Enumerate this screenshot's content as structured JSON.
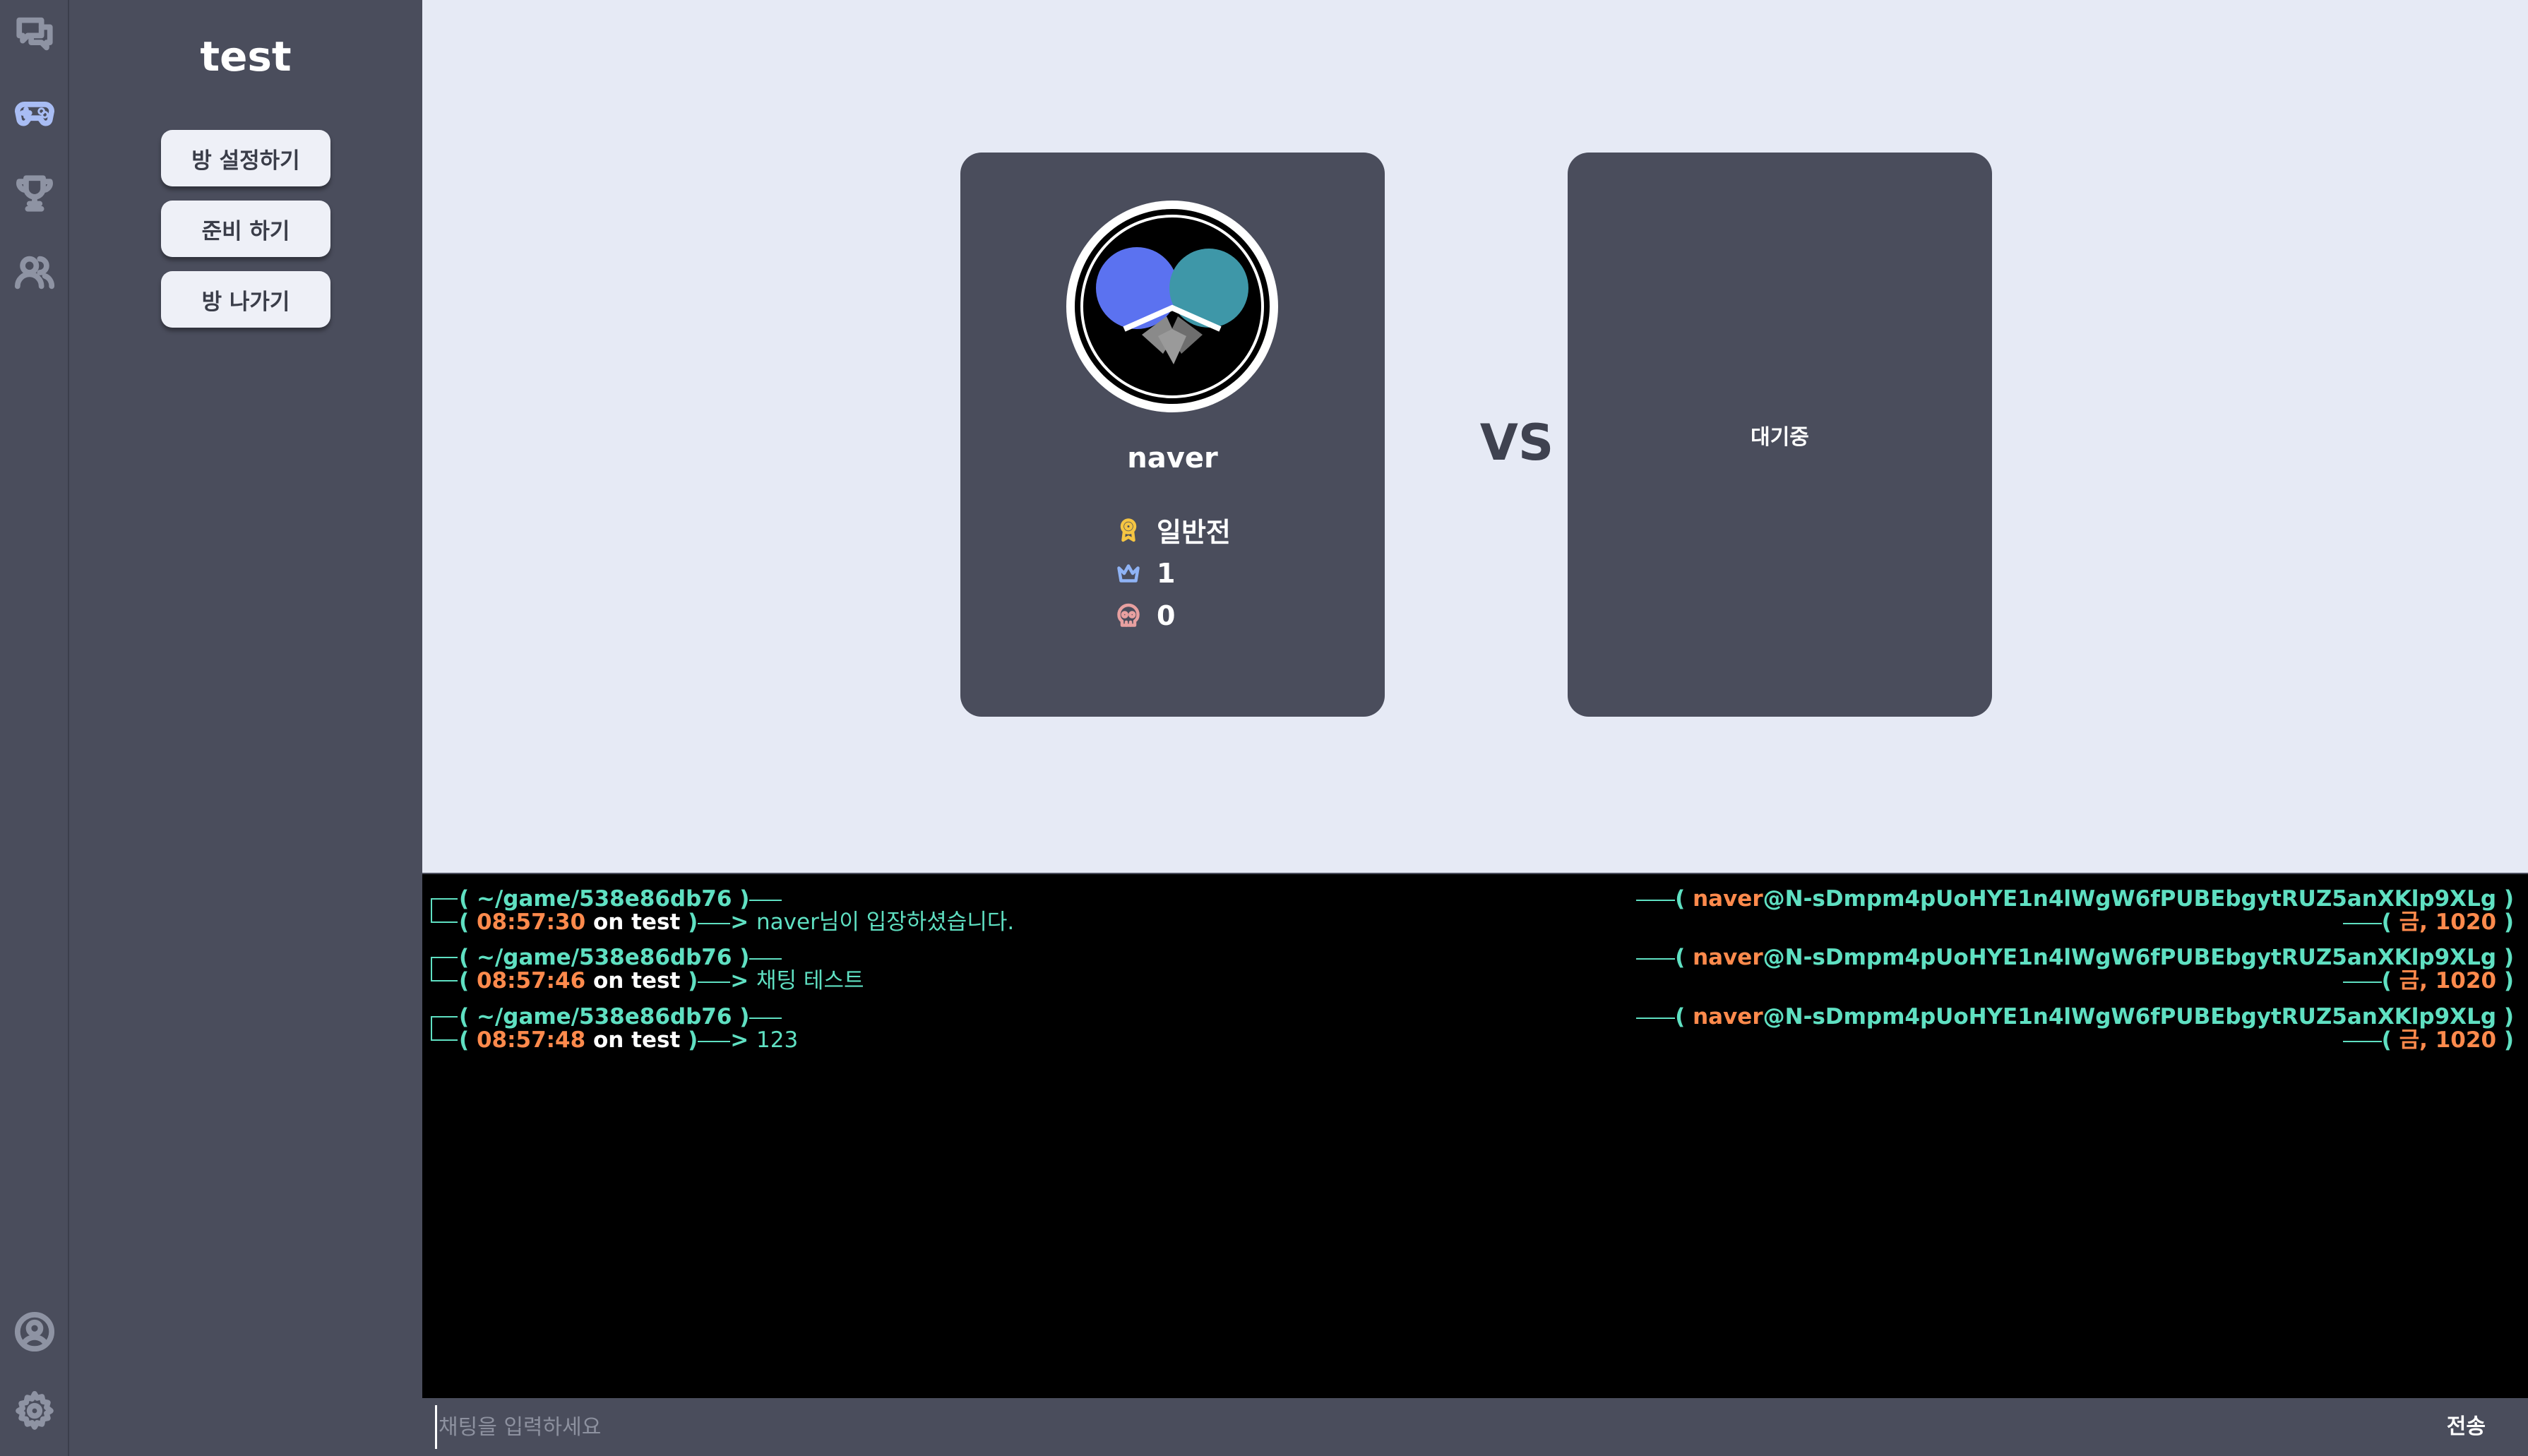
{
  "nav": {
    "top_icons": [
      "chat-icon",
      "gamepad-icon",
      "trophy-icon",
      "users-icon"
    ],
    "bottom_icons": [
      "profile-icon",
      "gear-icon"
    ],
    "active": "gamepad-icon"
  },
  "sidebar": {
    "title": "test",
    "buttons": [
      {
        "label": "방 설정하기"
      },
      {
        "label": "준비 하기"
      },
      {
        "label": "방 나가기"
      }
    ]
  },
  "match": {
    "vs_label": "VS",
    "player1": {
      "nickname": "naver",
      "avatar_icon": "ping-pong-paddles-icon",
      "stats": [
        {
          "icon": "medal-icon",
          "value": "일반전",
          "color": "#f5c542"
        },
        {
          "icon": "crown-icon",
          "value": "1",
          "color": "#8fb3f5"
        },
        {
          "icon": "skull-icon",
          "value": "0",
          "color": "#e8a0a0"
        }
      ]
    },
    "player2": {
      "status": "대기중"
    }
  },
  "chat": {
    "messages": [
      {
        "path": "~/game/538e86db76",
        "time": "08:57:30",
        "on": "on",
        "room": "test",
        "text": "naver님이 입장하셨습니다.",
        "user": "naver",
        "host": "@N-sDmpm4pUoHYE1n4lWgW6fPUBEbgytRUZ5anXKlp9XLg",
        "day": "금",
        "date": ", 1020"
      },
      {
        "path": "~/game/538e86db76",
        "time": "08:57:46",
        "on": "on",
        "room": "test",
        "text": "채팅 테스트",
        "user": "naver",
        "host": "@N-sDmpm4pUoHYE1n4lWgW6fPUBEbgytRUZ5anXKlp9XLg",
        "day": "금",
        "date": ", 1020"
      },
      {
        "path": "~/game/538e86db76",
        "time": "08:57:48",
        "on": "on",
        "room": "test",
        "text": "123",
        "user": "naver",
        "host": "@N-sDmpm4pUoHYE1n4lWgW6fPUBEbgytRUZ5anXKlp9XLg",
        "day": "금",
        "date": ", 1020"
      }
    ],
    "input_placeholder": "채팅을 입력하세요",
    "send_label": "전송"
  },
  "colors": {
    "panel": "#4a4d5c",
    "background": "#e6eaf5",
    "terminal_teal": "#5fe0c2",
    "terminal_orange": "#ff8a4c"
  }
}
